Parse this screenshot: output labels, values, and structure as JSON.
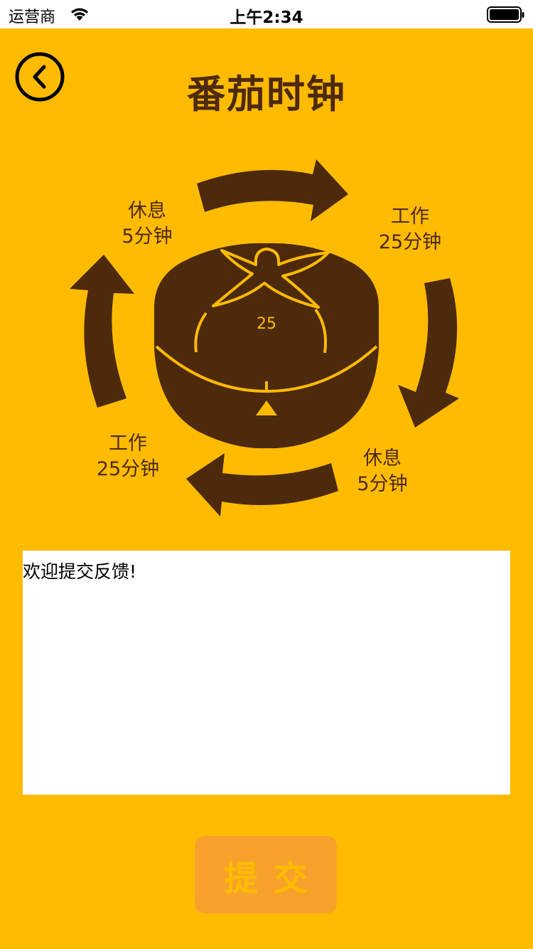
{
  "status_bar": {
    "carrier": "运营商",
    "time": "上午2:34"
  },
  "header": {
    "title": "番茄时钟",
    "back_icon": "chevron-left-circle-icon"
  },
  "illustration": {
    "timer_value": "25",
    "labels": [
      {
        "line1": "休息",
        "line2": "5分钟"
      },
      {
        "line1": "工作",
        "line2": "25分钟"
      },
      {
        "line1": "休息",
        "line2": "5分钟"
      },
      {
        "line1": "工作",
        "line2": "25分钟"
      }
    ]
  },
  "feedback": {
    "value": "欢迎提交反馈!"
  },
  "submit": {
    "label": "提交"
  },
  "colors": {
    "background": "#ffbb00",
    "brown": "#4d2a0c",
    "button": "#f7a12c"
  }
}
